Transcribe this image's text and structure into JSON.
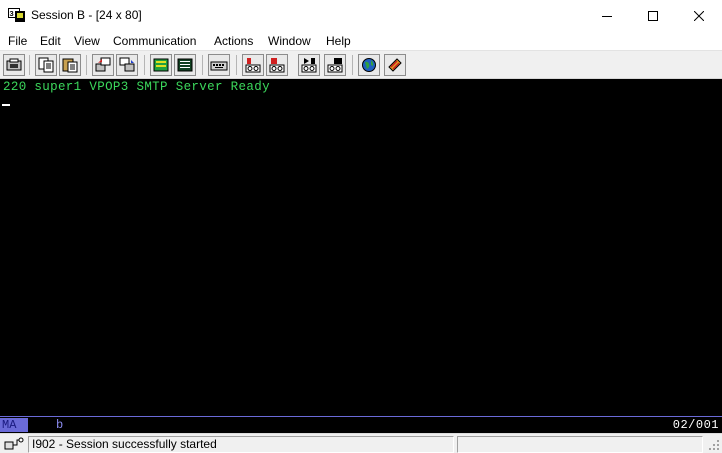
{
  "window": {
    "title": "Session B - [24 x 80]",
    "minimize_icon": "minimize-icon",
    "maximize_icon": "maximize-icon",
    "close_icon": "close-icon"
  },
  "menu": [
    {
      "label": "File"
    },
    {
      "label": "Edit"
    },
    {
      "label": "View"
    },
    {
      "label": "Communication"
    },
    {
      "label": "Actions"
    },
    {
      "label": "Window"
    },
    {
      "label": "Help"
    }
  ],
  "toolbar": [
    {
      "icon": "print-screen-icon"
    },
    {
      "icon": "copy-icon"
    },
    {
      "icon": "paste-icon"
    },
    {
      "icon": "send-file-icon"
    },
    {
      "icon": "receive-file-icon"
    },
    {
      "icon": "display-settings-icon"
    },
    {
      "icon": "keyboard-map-icon"
    },
    {
      "icon": "keypad-icon"
    },
    {
      "icon": "record-macro-icon"
    },
    {
      "icon": "stop-macro-icon"
    },
    {
      "icon": "play-macro-icon"
    },
    {
      "icon": "play-macro-alt-icon"
    },
    {
      "icon": "support-globe-icon"
    },
    {
      "icon": "help-index-icon"
    }
  ],
  "terminal": {
    "line1": "220 super1 VPOP3 SMTP Server Ready"
  },
  "oia": {
    "mode": "MA",
    "indicator": "b",
    "cursor_position": "02/001"
  },
  "status": {
    "message": "I902 - Session successfully started"
  },
  "colors": {
    "terminal_bg": "#000000",
    "terminal_text": "#3cd85c",
    "oia_accent": "#6a6ad8"
  }
}
